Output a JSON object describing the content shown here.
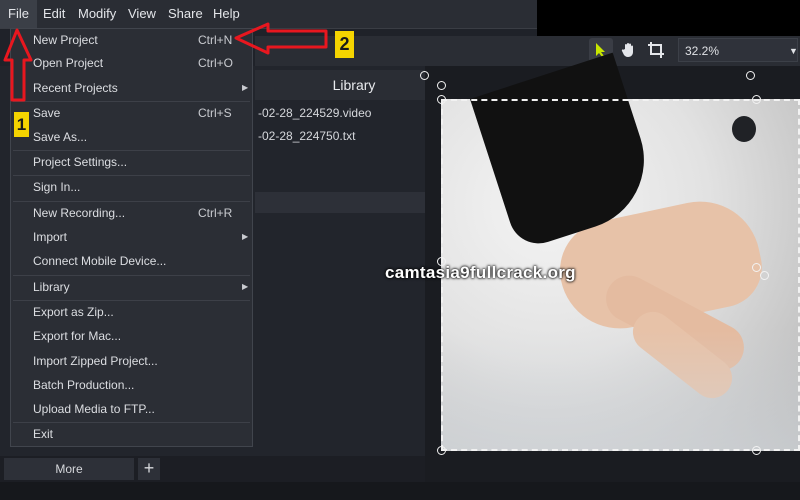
{
  "menubar": {
    "items": [
      "File",
      "Edit",
      "Modify",
      "View",
      "Share",
      "Help"
    ]
  },
  "toolbar": {
    "zoom_value": "32.2%",
    "zoom_options_icon": "chevron-down-icon",
    "tools": [
      "pointer-icon",
      "hand-icon",
      "crop-icon"
    ]
  },
  "library": {
    "title": "Library",
    "files": [
      "-02-28_224529.video",
      "-02-28_224750.txt"
    ]
  },
  "bottom": {
    "more_label": "More",
    "add_label": "+"
  },
  "file_menu": {
    "items": [
      {
        "label": "New Project",
        "shortcut": "Ctrl+N"
      },
      {
        "label": "Open Project",
        "shortcut": "Ctrl+O"
      },
      {
        "label": "Recent Projects",
        "submenu": true
      },
      {
        "label": "Save",
        "shortcut": "Ctrl+S"
      },
      {
        "label": "Save As..."
      },
      {
        "label": "Project Settings..."
      },
      {
        "label": "Sign In..."
      },
      {
        "label": "New Recording...",
        "shortcut": "Ctrl+R"
      },
      {
        "label": "Import",
        "submenu": true
      },
      {
        "label": "Connect Mobile Device..."
      },
      {
        "label": "Library",
        "submenu": true
      },
      {
        "label": "Export as Zip..."
      },
      {
        "label": "Export for Mac..."
      },
      {
        "label": "Import Zipped Project..."
      },
      {
        "label": "Batch Production..."
      },
      {
        "label": "Upload Media to FTP..."
      },
      {
        "label": "Exit"
      }
    ]
  },
  "annotations": {
    "badge_1": "1",
    "badge_2": "2",
    "arrow_color": "#e8171f",
    "badge_color": "#f5d400"
  },
  "watermark": "camtasia9fullcrack.org",
  "colors": {
    "accent_pointer": "#c8e600"
  }
}
